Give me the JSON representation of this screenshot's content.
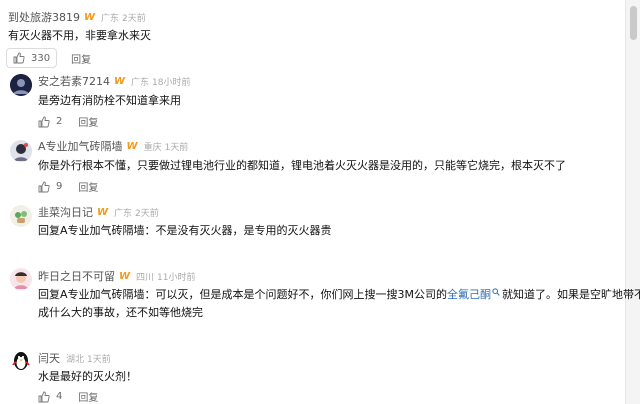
{
  "comments": [
    {
      "user": "到处旅游3819",
      "badge": "W",
      "location": "广东",
      "time": "2天前",
      "text": "有灭火器不用，非要拿水来灭",
      "likes": "330",
      "reply_label": "回复"
    },
    {
      "user": "安之若素7214",
      "badge": "W",
      "location": "广东",
      "time": "18小时前",
      "text": "是旁边有消防栓不知道拿来用",
      "likes": "2",
      "reply_label": "回复"
    },
    {
      "user": "A专业加气砖隔墙",
      "badge": "W",
      "location": "重庆",
      "time": "1天前",
      "text": "你是外行根本不懂，只要做过锂电池行业的都知道，锂电池着火灭火器是没用的，只能等它烧完，根本灭不了",
      "likes": "9",
      "reply_label": "回复"
    },
    {
      "user": "韭菜沟日记",
      "badge": "W",
      "location": "广东",
      "time": "2天前",
      "text": "回复A专业加气砖隔墙：不是没有灭火器，是专用的灭火器贵"
    },
    {
      "user": "昨日之日不可留",
      "badge": "W",
      "location": "四川",
      "time": "11小时前",
      "text_line1_pre": "回复A专业加气砖隔墙：可以灭，但是成本是个问题好不，你们网上搜一搜3M公司的",
      "text_link": "全氟己酮",
      "text_line1_post": "就知道了。如果是空旷地带不会造",
      "text_line2": "成什么大的事故，还不如等他烧完"
    },
    {
      "user": "闫天",
      "location": "湖北",
      "time": "1天前",
      "text": "水是最好的灭火剂！",
      "likes": "4",
      "reply_label": "回复"
    }
  ],
  "colors": {
    "vip_badge": "#f39a1b",
    "link": "#2f6db5",
    "meta": "#aaaaaa"
  }
}
